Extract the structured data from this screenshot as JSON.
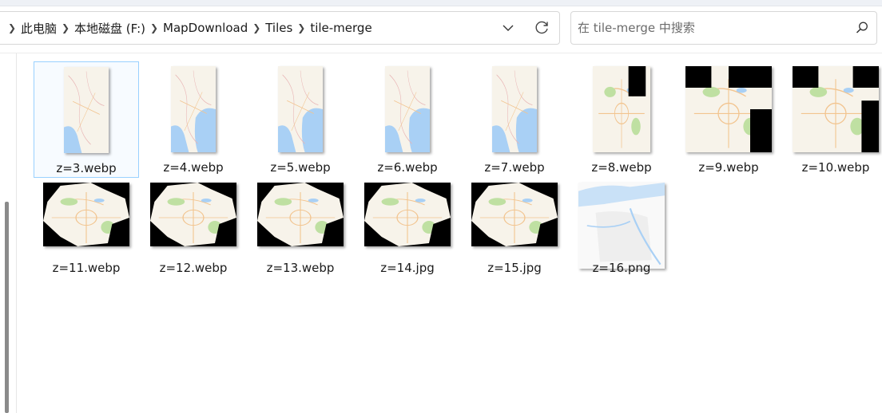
{
  "address_bar": {
    "breadcrumbs": [
      "此电脑",
      "本地磁盘 (F:)",
      "MapDownload",
      "Tiles",
      "tile-merge"
    ]
  },
  "search": {
    "placeholder": "在 tile-merge 中搜索"
  },
  "files": [
    {
      "name": "z=3.webp",
      "selected": true
    },
    {
      "name": "z=4.webp"
    },
    {
      "name": "z=5.webp"
    },
    {
      "name": "z=6.webp"
    },
    {
      "name": "z=7.webp"
    },
    {
      "name": "z=8.webp"
    },
    {
      "name": "z=9.webp"
    },
    {
      "name": "z=10.webp"
    },
    {
      "name": "z=11.webp"
    },
    {
      "name": "z=12.webp"
    },
    {
      "name": "z=13.webp"
    },
    {
      "name": "z=14.jpg"
    },
    {
      "name": "z=15.jpg"
    },
    {
      "name": "z=16.png"
    }
  ],
  "colors": {
    "map_land": "#f7f3ea",
    "map_water": "#a9d0f5",
    "map_park": "#bfe0a2",
    "map_road": "#f2c48f",
    "map_border": "#e8b4b4",
    "tile_empty": "#000000",
    "selection_border": "#99d1ff"
  }
}
